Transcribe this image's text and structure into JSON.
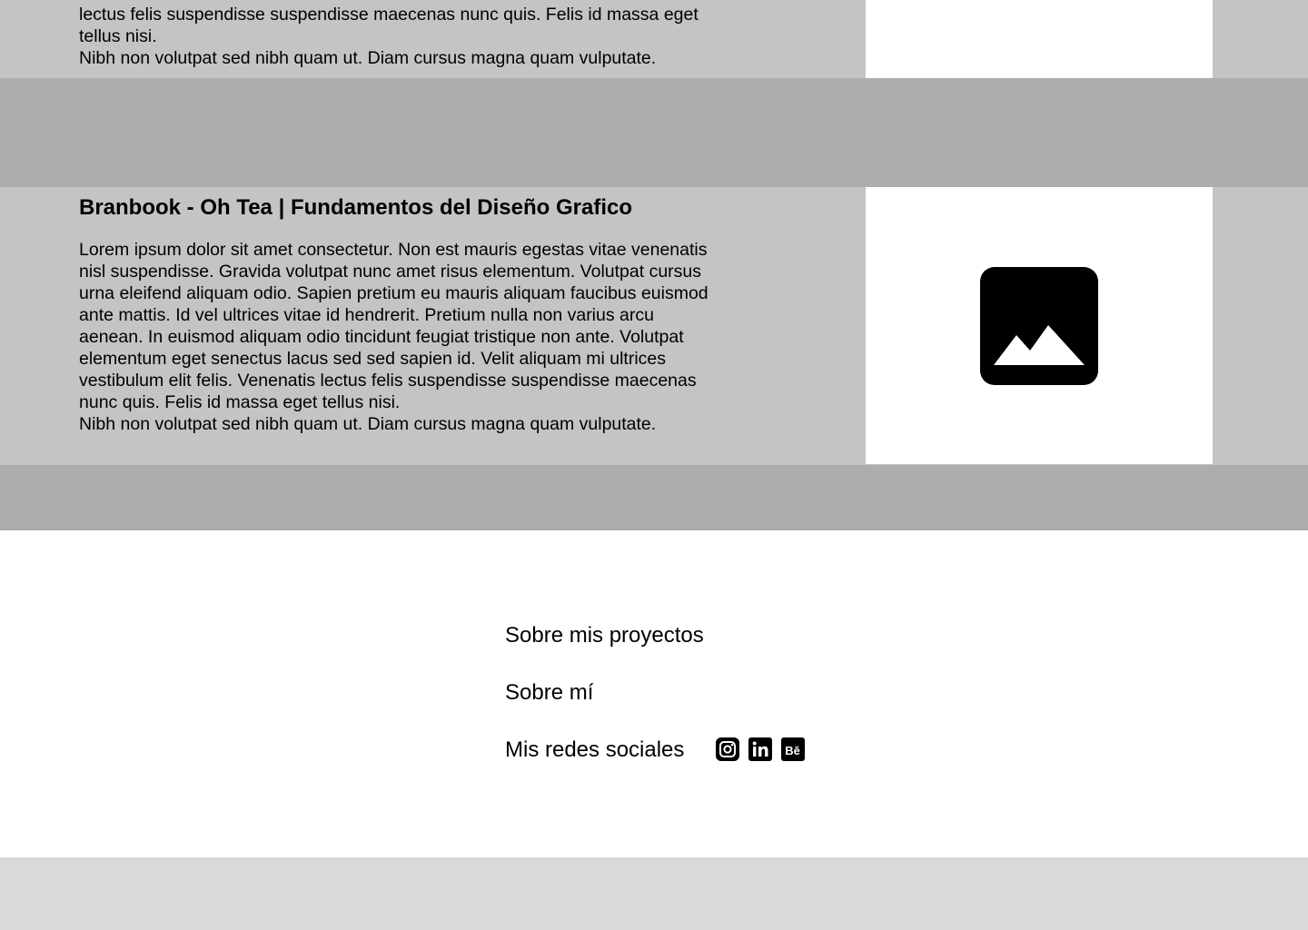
{
  "project_top": {
    "desc_lines": [
      "lectus felis suspendisse suspendisse maecenas nunc quis. Felis id massa eget tellus nisi.",
      "Nibh non volutpat sed nibh quam ut. Diam cursus magna quam vulputate."
    ]
  },
  "project_main": {
    "title": "Branbook - Oh Tea | Fundamentos del Diseño Grafico",
    "desc_lines": [
      "Lorem ipsum dolor sit amet consectetur. Non est mauris egestas vitae venenatis nisl suspendisse. Gravida volutpat nunc amet risus elementum. Volutpat cursus urna eleifend aliquam odio. Sapien pretium eu mauris aliquam faucibus euismod ante mattis. Id vel ultrices vitae id hendrerit. Pretium nulla non varius arcu aenean. In euismod aliquam odio tincidunt feugiat tristique non ante. Volutpat elementum eget senectus lacus sed sed sapien id. Velit aliquam mi ultrices vestibulum elit felis. Venenatis lectus felis suspendisse suspendisse maecenas nunc quis. Felis id massa eget tellus nisi.",
      "Nibh non volutpat sed nibh quam ut. Diam cursus magna quam vulputate."
    ],
    "image_icon": "image-placeholder-icon"
  },
  "footer": {
    "links": [
      "Sobre mis proyectos",
      "Sobre mí",
      "Mis redes sociales"
    ],
    "social_icons": [
      "instagram-icon",
      "linkedin-icon",
      "behance-icon"
    ]
  },
  "colors": {
    "project_bg": "#c4c4c4",
    "spacer_bg": "#adadad",
    "bottom_bg": "#d9d9d9",
    "panel_bg": "#ffffff",
    "icon": "#000000"
  }
}
